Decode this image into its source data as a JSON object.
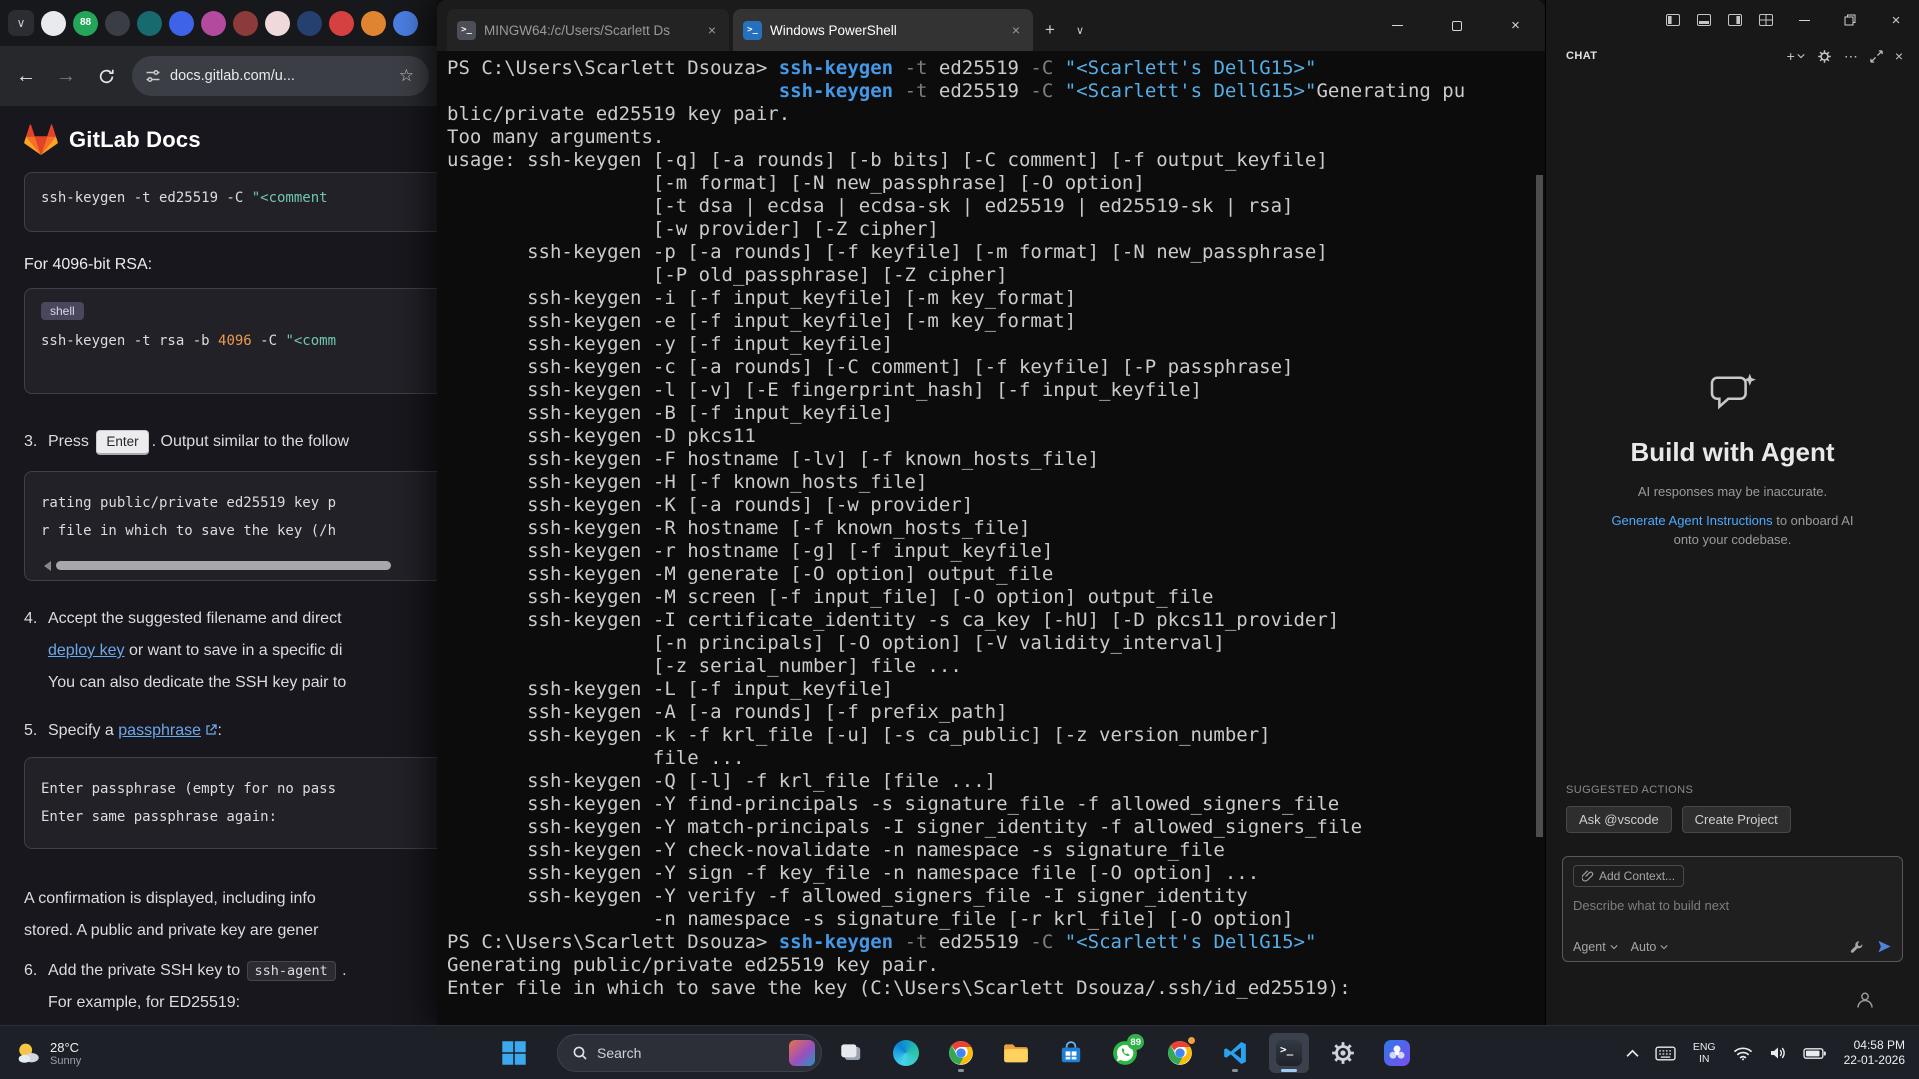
{
  "colors": {
    "gitlab_orange": "#fc6d26",
    "link_blue": "#6ca8ea",
    "terminal_cmd": "#4598e6",
    "terminal_string": "#57aee6",
    "vscode_link": "#4daafc",
    "taskbar_badge_green": "#31b14c"
  },
  "browser": {
    "address": "docs.gitlab.com/u...",
    "favicons": [
      {
        "bg": "#e9eaee"
      },
      {
        "bg": "#23a55a",
        "label": "88"
      },
      {
        "bg": "#3a3d44"
      },
      {
        "bg": "#176a6e"
      },
      {
        "bg": "#3e62e8"
      },
      {
        "bg": "#b34a9e"
      },
      {
        "bg": "#8c3a3a"
      },
      {
        "bg": "#efd9da"
      },
      {
        "bg": "#253f6e"
      },
      {
        "bg": "#d64040"
      },
      {
        "bg": "#e0852f"
      },
      {
        "bg": "#4a7de0"
      }
    ],
    "page": {
      "title": "GitLab Docs",
      "code_top_a": "ssh-keygen -t ed25519 -C ",
      "code_top_str": "\"<comment",
      "rsa_heading": "For 4096-bit RSA:",
      "shell_badge": "shell",
      "rsa_code_a": "ssh-keygen -t rsa -b ",
      "rsa_code_num": "4096",
      "rsa_code_b": " -C ",
      "rsa_code_str": "\"<comm",
      "step3_num": "3.",
      "step3_a": "Press ",
      "step3_kbd": "Enter",
      "step3_b": ". Output similar to the follow",
      "out_line1": "rating public/private ed25519 key p",
      "out_line2": "r file in which to save the key (/h",
      "step4_num": "4.",
      "step4_l1": "Accept the suggested filename and direct",
      "step4_link": "deploy key",
      "step4_l2": " or want to save in a specific di",
      "step4_l3": "You can also dedicate the SSH key pair to",
      "step5_num": "5.",
      "step5_a": "Specify a ",
      "step5_link": "passphrase",
      "step5_b": ":",
      "pass_line1": "Enter passphrase (empty for no pass",
      "pass_line2": "Enter same passphrase again:",
      "para_l1": "A confirmation is displayed, including info",
      "para_l2": "stored. A public and private key are gener",
      "step6_num": "6.",
      "step6_a": "Add the private SSH key to ",
      "step6_code": "ssh-agent",
      "step6_b": " .",
      "step6_l2": "For example, for ED25519:"
    }
  },
  "terminal": {
    "tab1": "MINGW64:/c/Users/Scarlett Ds",
    "tab2": "Windows PowerShell",
    "lines": [
      [
        {
          "t": "PS C:\\Users\\Scarlett Dsouza> "
        },
        {
          "t": "ssh-keygen",
          "c": "cmd"
        },
        {
          "t": " "
        },
        {
          "t": "-t",
          "c": "param"
        },
        {
          "t": " ed25519 "
        },
        {
          "t": "-C",
          "c": "param"
        },
        {
          "t": " "
        },
        {
          "t": "\"<Scarlett's DellG15>\"",
          "c": "str"
        }
      ],
      [
        {
          "t": "                             "
        },
        {
          "t": "ssh-keygen",
          "c": "cmd"
        },
        {
          "t": " "
        },
        {
          "t": "-t",
          "c": "param"
        },
        {
          "t": " ed25519 "
        },
        {
          "t": "-C",
          "c": "param"
        },
        {
          "t": " "
        },
        {
          "t": "\"<Scarlett's DellG15>\"",
          "c": "str"
        },
        {
          "t": "Generating pu"
        }
      ],
      "blic/private ed25519 key pair.",
      "Too many arguments.",
      "usage: ssh-keygen [-q] [-a rounds] [-b bits] [-C comment] [-f output_keyfile]",
      "                  [-m format] [-N new_passphrase] [-O option]",
      "                  [-t dsa | ecdsa | ecdsa-sk | ed25519 | ed25519-sk | rsa]",
      "                  [-w provider] [-Z cipher]",
      "       ssh-keygen -p [-a rounds] [-f keyfile] [-m format] [-N new_passphrase]",
      "                  [-P old_passphrase] [-Z cipher]",
      "       ssh-keygen -i [-f input_keyfile] [-m key_format]",
      "       ssh-keygen -e [-f input_keyfile] [-m key_format]",
      "       ssh-keygen -y [-f input_keyfile]",
      "       ssh-keygen -c [-a rounds] [-C comment] [-f keyfile] [-P passphrase]",
      "       ssh-keygen -l [-v] [-E fingerprint_hash] [-f input_keyfile]",
      "       ssh-keygen -B [-f input_keyfile]",
      "       ssh-keygen -D pkcs11",
      "       ssh-keygen -F hostname [-lv] [-f known_hosts_file]",
      "       ssh-keygen -H [-f known_hosts_file]",
      "       ssh-keygen -K [-a rounds] [-w provider]",
      "       ssh-keygen -R hostname [-f known_hosts_file]",
      "       ssh-keygen -r hostname [-g] [-f input_keyfile]",
      "       ssh-keygen -M generate [-O option] output_file",
      "       ssh-keygen -M screen [-f input_file] [-O option] output_file",
      "       ssh-keygen -I certificate_identity -s ca_key [-hU] [-D pkcs11_provider]",
      "                  [-n principals] [-O option] [-V validity_interval]",
      "                  [-z serial_number] file ...",
      "       ssh-keygen -L [-f input_keyfile]",
      "       ssh-keygen -A [-a rounds] [-f prefix_path]",
      "       ssh-keygen -k -f krl_file [-u] [-s ca_public] [-z version_number]",
      "                  file ...",
      "       ssh-keygen -Q [-l] -f krl_file [file ...]",
      "       ssh-keygen -Y find-principals -s signature_file -f allowed_signers_file",
      "       ssh-keygen -Y match-principals -I signer_identity -f allowed_signers_file",
      "       ssh-keygen -Y check-novalidate -n namespace -s signature_file",
      "       ssh-keygen -Y sign -f key_file -n namespace file [-O option] ...",
      "       ssh-keygen -Y verify -f allowed_signers_file -I signer_identity",
      "                  -n namespace -s signature_file [-r krl_file] [-O option]",
      [
        {
          "t": "PS C:\\Users\\Scarlett Dsouza> "
        },
        {
          "t": "ssh-keygen",
          "c": "cmd"
        },
        {
          "t": " "
        },
        {
          "t": "-t",
          "c": "param"
        },
        {
          "t": " ed25519 "
        },
        {
          "t": "-C",
          "c": "param"
        },
        {
          "t": " "
        },
        {
          "t": "\"<Scarlett's DellG15>\"",
          "c": "str"
        }
      ],
      "Generating public/private ed25519 key pair.",
      "Enter file in which to save the key (C:\\Users\\Scarlett Dsouza/.ssh/id_ed25519):"
    ]
  },
  "vscode": {
    "chat_title": "CHAT",
    "hero_title": "Build with Agent",
    "hero_sub": "AI responses may be inaccurate.",
    "inst_link": "Generate Agent Instructions",
    "inst_rest": " to onboard AI",
    "inst_rest2": "onto your codebase.",
    "suggested_label": "SUGGESTED ACTIONS",
    "action1": "Ask @vscode",
    "action2": "Create Project",
    "add_context": "Add Context...",
    "input_placeholder": "Describe what to build next",
    "agent_select": "Agent",
    "model_select": "Auto"
  },
  "taskbar": {
    "weather_temp": "28°C",
    "weather_desc": "Sunny",
    "search_placeholder": "Search",
    "whatsapp_badge": "89",
    "lang1": "ENG",
    "lang2": "IN",
    "time": "04:58 PM",
    "date": "22-01-2026"
  }
}
